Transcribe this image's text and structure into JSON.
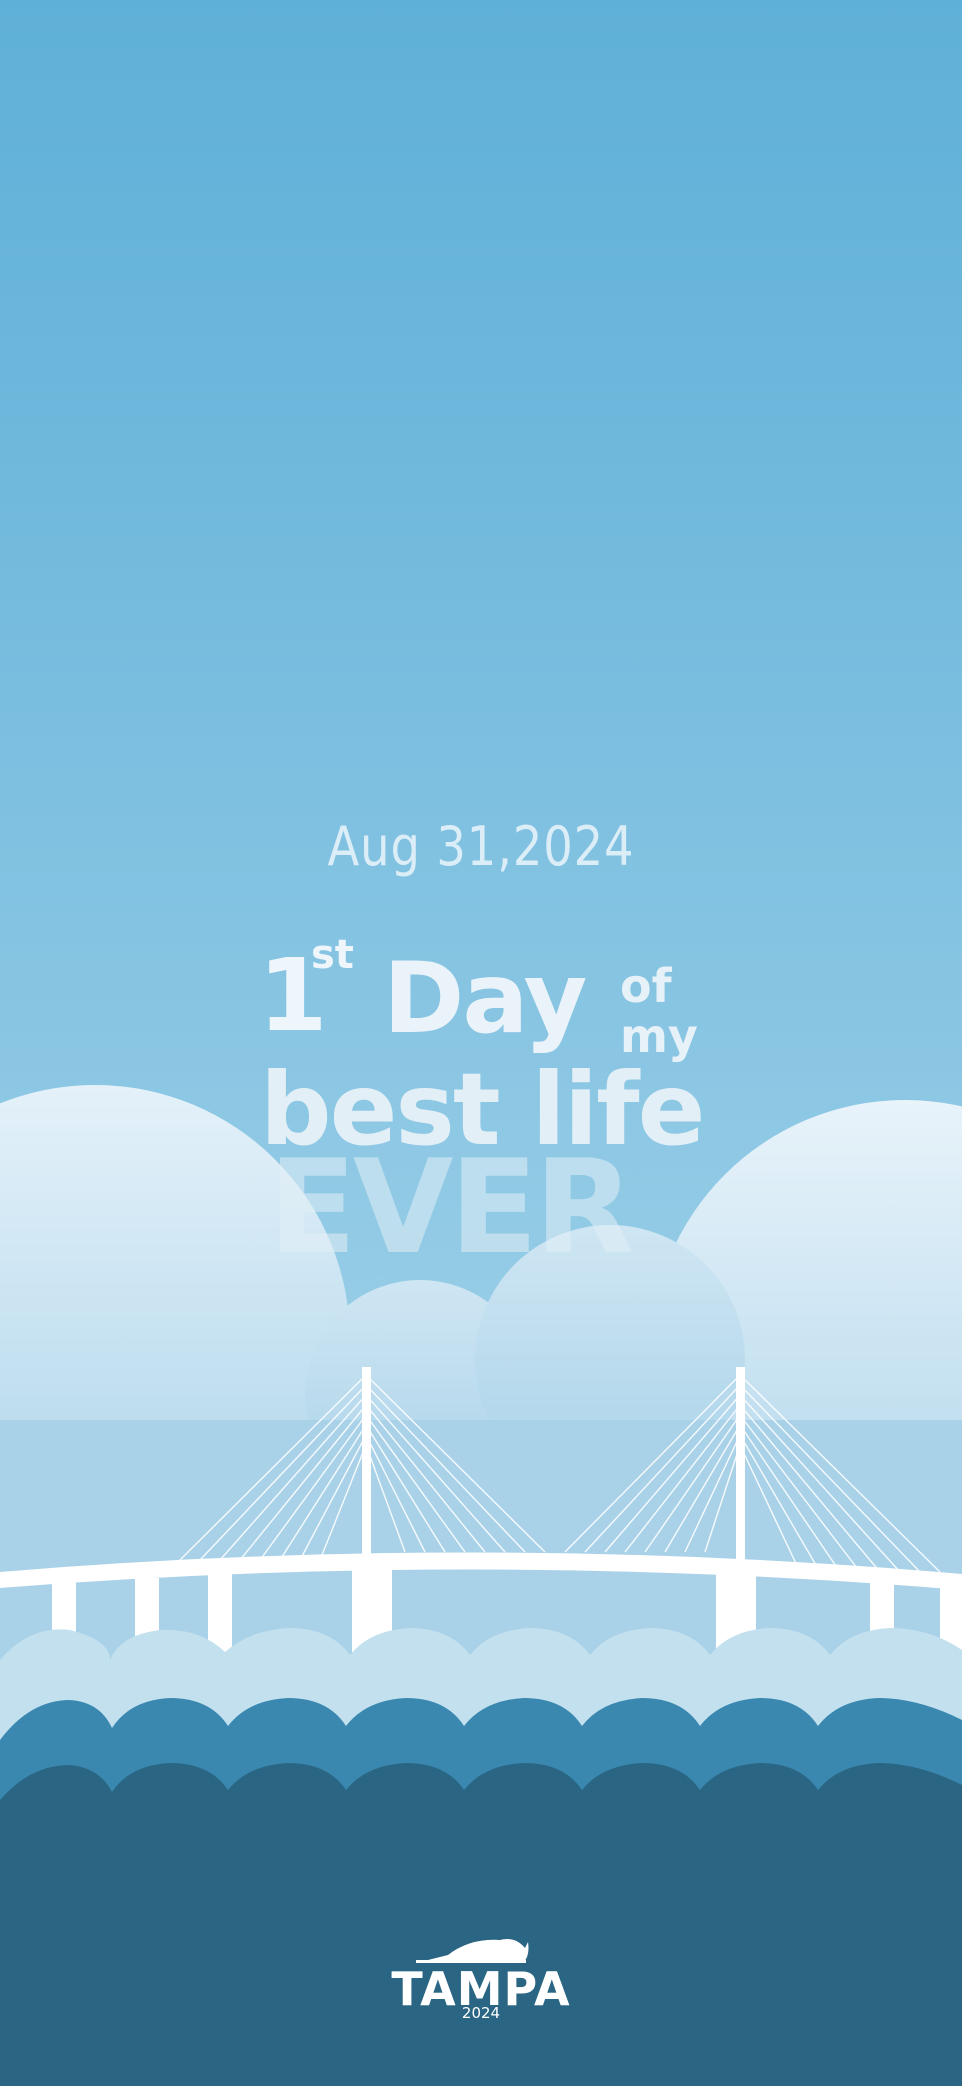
{
  "date": "Aug 31,2024",
  "headline": {
    "line1_number": "1",
    "line1_suffix": "st",
    "line1_word": "Day",
    "line1_small_top": "of",
    "line1_small_bottom": "my",
    "line2": "best life",
    "line3": "EVER"
  },
  "logo": {
    "name": "TAMPA",
    "year": "2024",
    "icon": "fish-icon"
  },
  "colors": {
    "sky_top": "#5fb0d8",
    "sky_bottom": "#a6d3ea",
    "cloud": "#cfe6f3",
    "wave_light": "#c3e0ef",
    "wave_mid": "#3a88b0",
    "water_deep": "#2a6683",
    "bridge": "#ffffff"
  }
}
